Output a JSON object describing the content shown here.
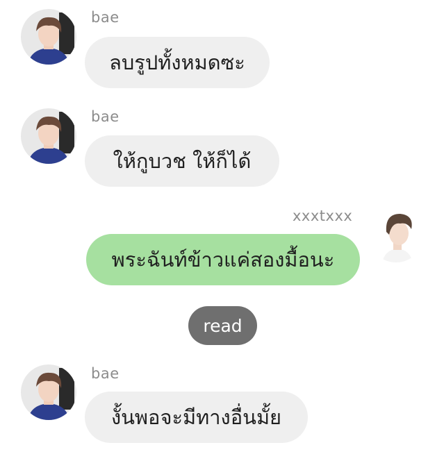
{
  "messages": [
    {
      "sender": "bae",
      "text": "ลบรูปทั้งหมดซะ",
      "direction": "incoming",
      "avatar": "bae-avatar"
    },
    {
      "sender": "bae",
      "text": "ให้กูบวช ให้ก็ได้",
      "direction": "incoming",
      "avatar": "bae-avatar"
    },
    {
      "sender": "xxxtxxx",
      "text": "พระฉันท์ข้าวแค่สองมื้อนะ",
      "direction": "outgoing",
      "avatar": "xxxtxxx-avatar"
    },
    {
      "sender": "bae",
      "text": "งั้นพอจะมีทางอื่นมั้ย",
      "direction": "incoming",
      "avatar": "bae-avatar"
    }
  ],
  "read_receipt": "read",
  "colors": {
    "incoming_bubble": "#efefef",
    "outgoing_bubble": "#a6e0a0",
    "read_pill": "#6f6f6f",
    "sender_text": "#8c8c8c"
  }
}
